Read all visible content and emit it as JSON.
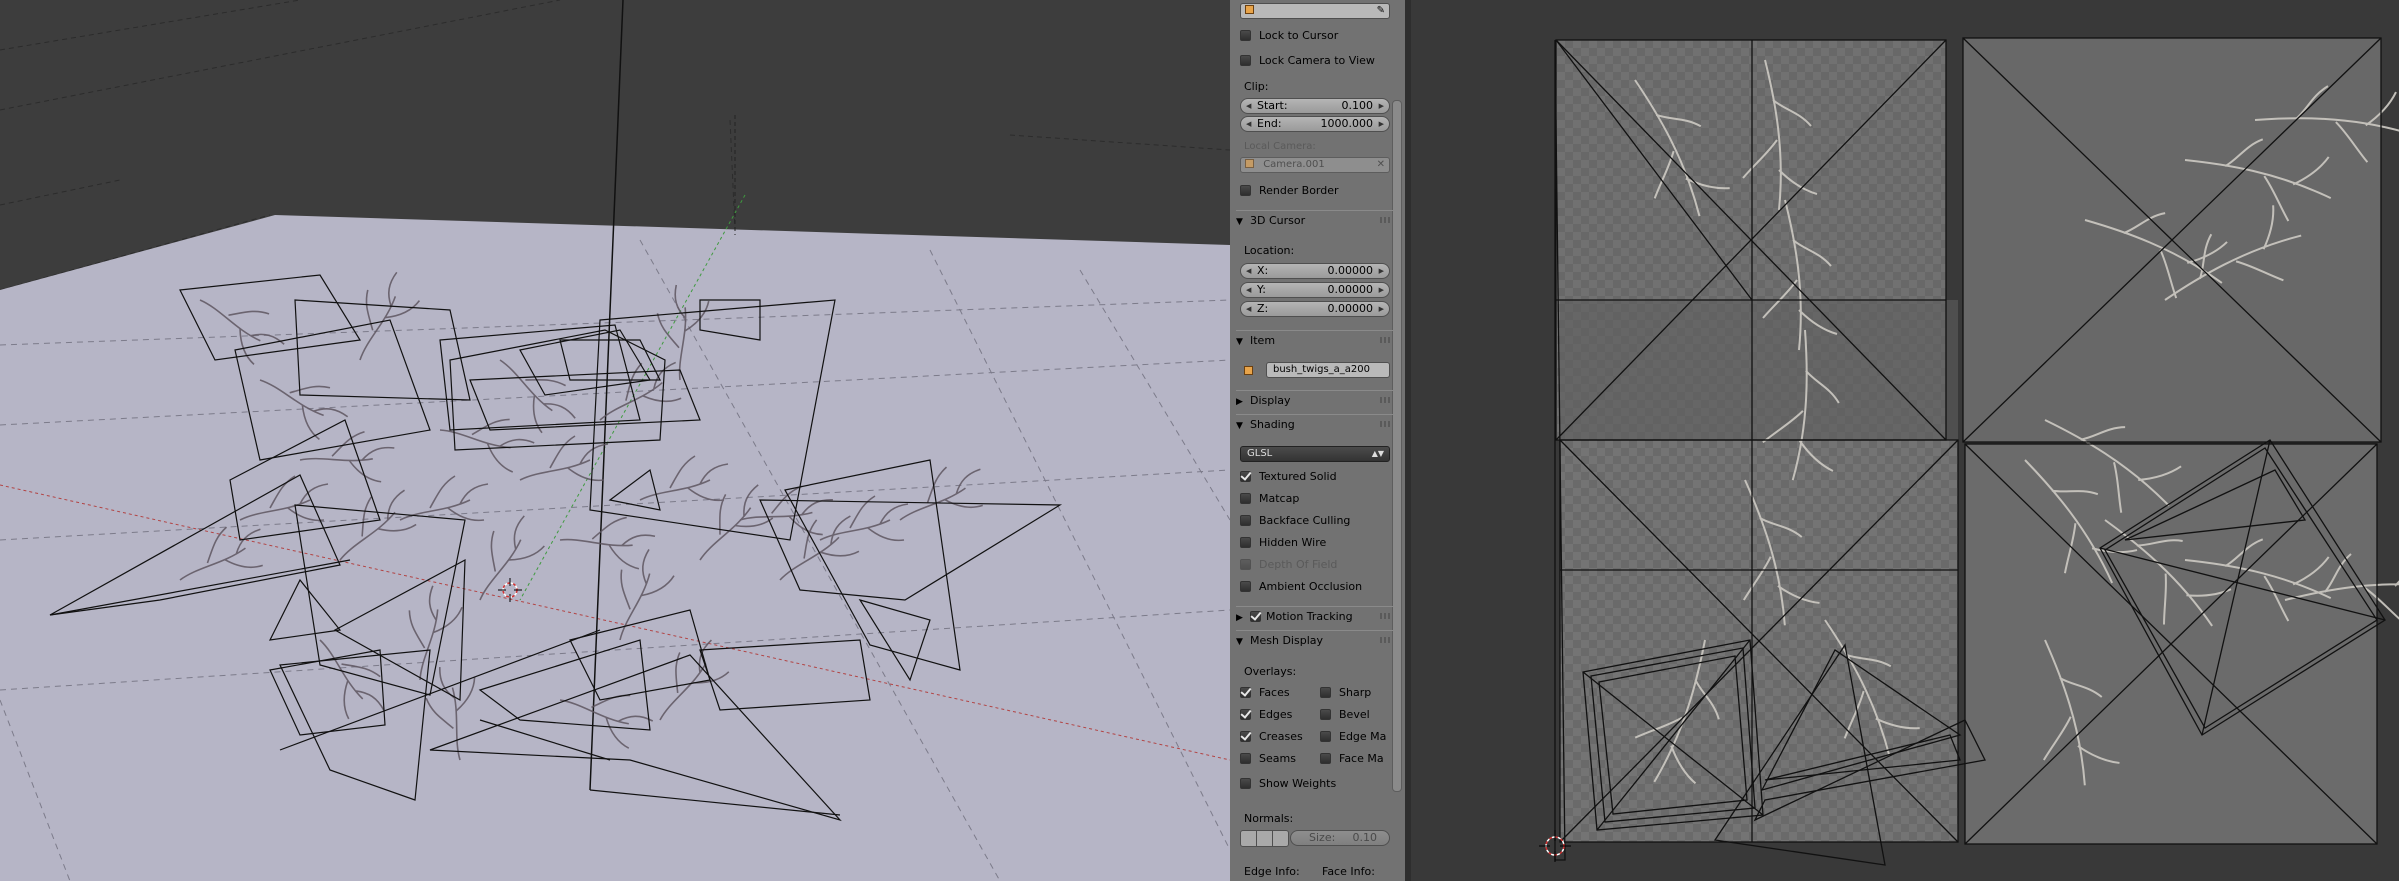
{
  "panel": {
    "camera_field": "",
    "lock_to_cursor": "Lock to Cursor",
    "lock_camera_to_view": "Lock Camera to View",
    "clip_label": "Clip:",
    "clip_start_label": "Start:",
    "clip_start_value": "0.100",
    "clip_end_label": "End:",
    "clip_end_value": "1000.000",
    "local_camera_label": "Local Camera:",
    "local_camera_value": "Camera.001",
    "render_border": "Render Border",
    "cursor_header": "3D Cursor",
    "location_label": "Location:",
    "x_label": "X:",
    "x_value": "0.00000",
    "y_label": "Y:",
    "y_value": "0.00000",
    "z_label": "Z:",
    "z_value": "0.00000",
    "item_header": "Item",
    "item_name": "bush_twigs_a_a200",
    "display_header": "Display",
    "shading_header": "Shading",
    "shading_mode": "GLSL",
    "textured_solid": "Textured Solid",
    "matcap": "Matcap",
    "backface_culling": "Backface Culling",
    "hidden_wire": "Hidden Wire",
    "depth_of_field": "Depth Of Field",
    "ambient_occlusion": "Ambient Occlusion",
    "motion_tracking_header": "Motion Tracking",
    "mesh_display_header": "Mesh Display",
    "overlays_label": "Overlays:",
    "faces": "Faces",
    "sharp": "Sharp",
    "edges": "Edges",
    "bevel": "Bevel",
    "creases": "Creases",
    "edge_marks": "Edge Ma",
    "seams": "Seams",
    "face_marks": "Face Ma",
    "show_weights": "Show Weights",
    "normals_label": "Normals:",
    "size_label": "Size:",
    "size_value": "0.10",
    "edge_info": "Edge Info:",
    "face_info": "Face Info:"
  },
  "colors": {
    "viewport_bg": "#3d3d3d",
    "ground_plane": "#b6b5c6",
    "panel_bg": "#727272",
    "uv_bg": "#393939",
    "object_icon": "#e8a44a"
  },
  "icons": {
    "camera_field_icon": "object-cube-icon",
    "eyedropper": "eyedropper-icon",
    "clear": "x-icon",
    "cursor_3d": "3d-cursor-icon",
    "uv_cursor": "2d-cursor-icon"
  }
}
